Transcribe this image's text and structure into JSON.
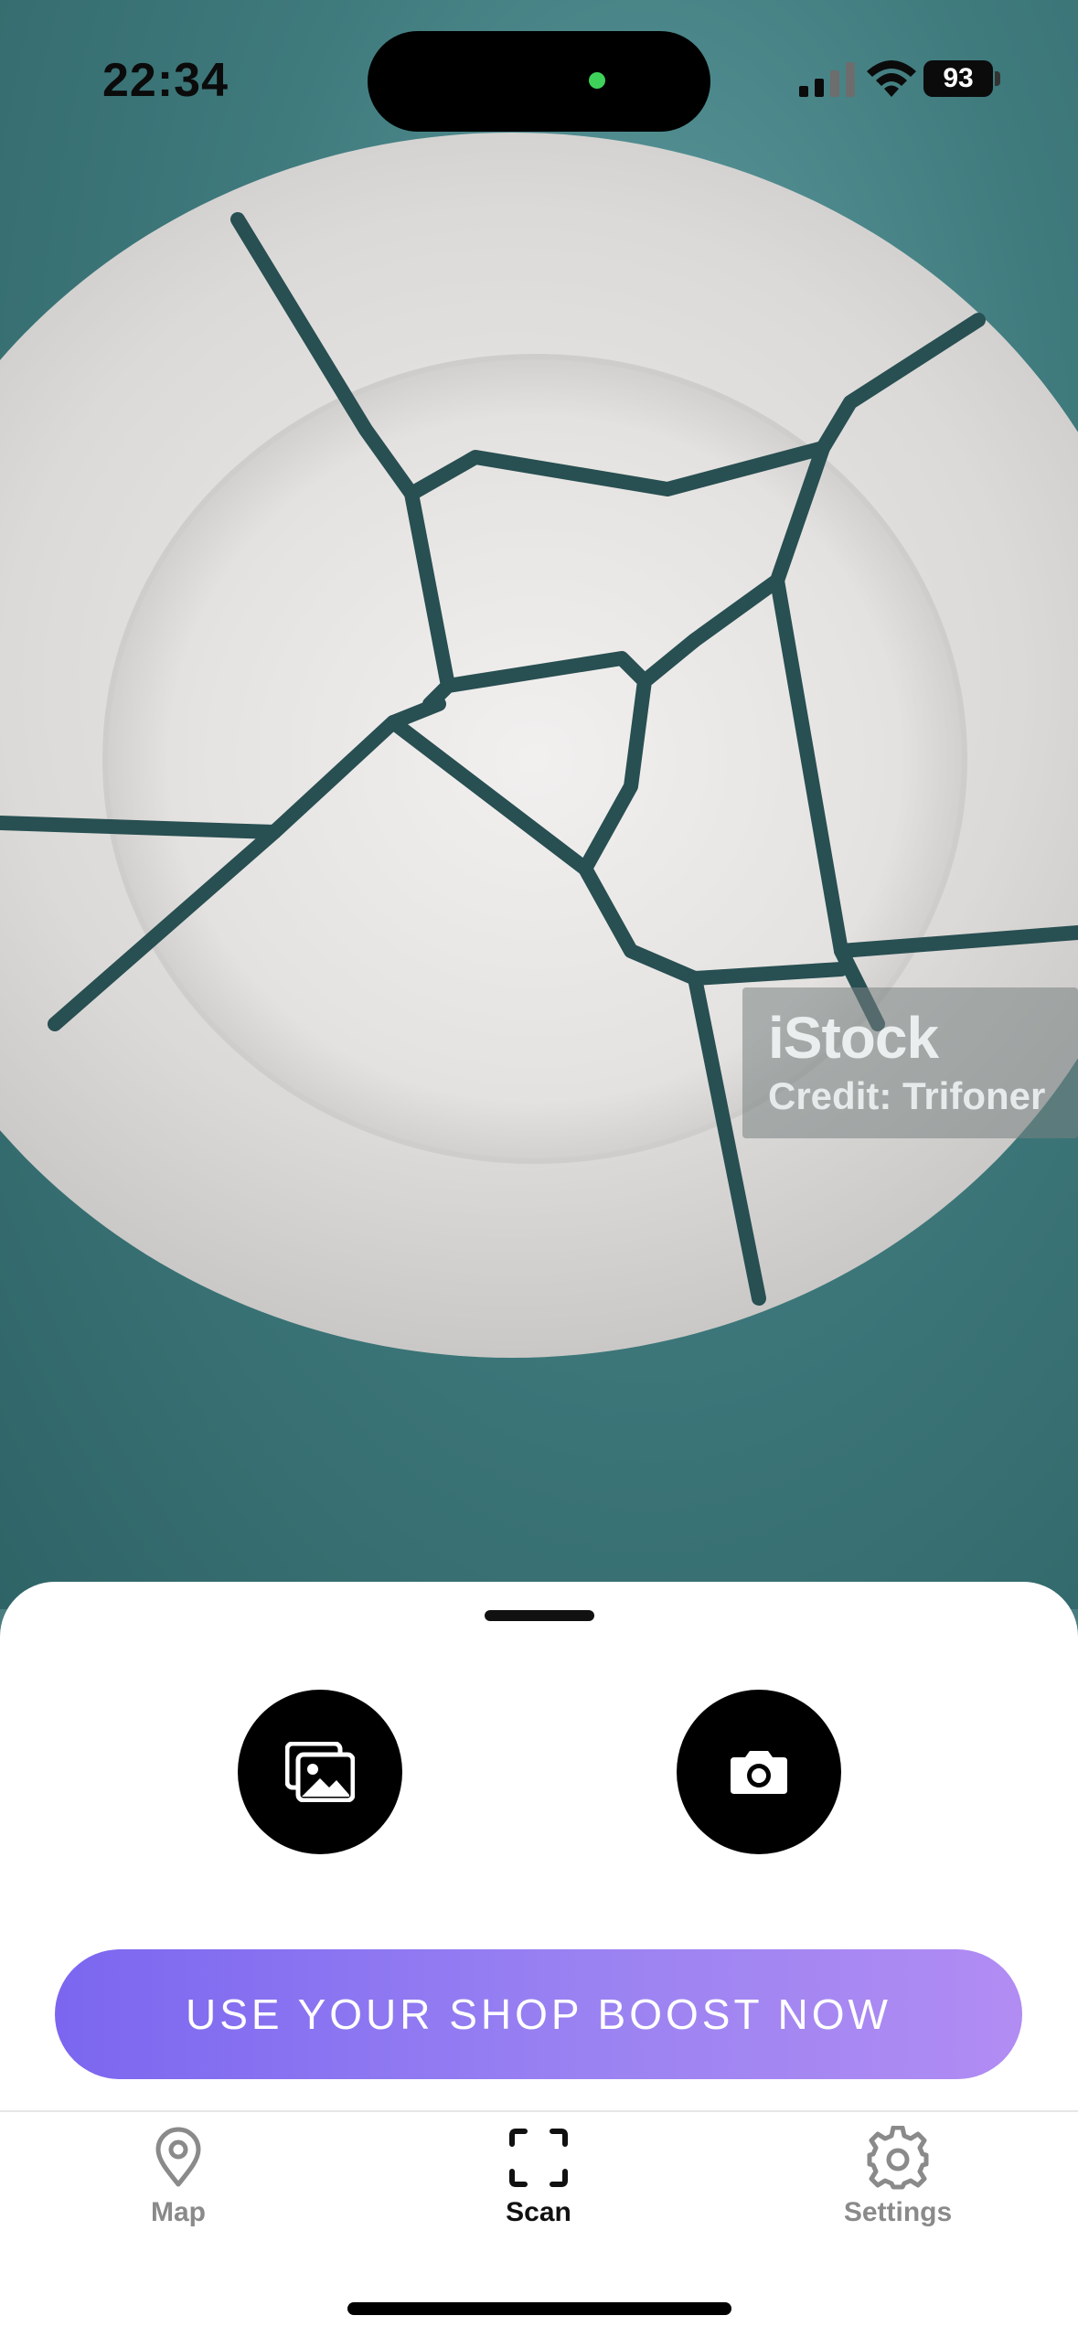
{
  "status_bar": {
    "time": "22:34",
    "battery": "93",
    "icons": [
      "signal-icon",
      "wifi-icon",
      "battery-icon"
    ]
  },
  "camera": {
    "watermark_logo": "iStock",
    "watermark_credit": "Credit: Trifoner"
  },
  "actions": {
    "gallery_icon": "photo-gallery-icon",
    "camera_icon": "camera-icon"
  },
  "promo": {
    "button_label": "USE YOUR SHOP BOOST NOW"
  },
  "tabbar": {
    "tabs": [
      {
        "label": "Map",
        "icon": "map-pin-icon",
        "active": false
      },
      {
        "label": "Scan",
        "icon": "scan-icon",
        "active": true
      },
      {
        "label": "Settings",
        "icon": "gear-icon",
        "active": false
      }
    ]
  },
  "colors": {
    "accent_start": "#7b66f0",
    "accent_end": "#b18cf3",
    "active_tab": "#111111",
    "inactive_tab": "#8a8a8a"
  }
}
